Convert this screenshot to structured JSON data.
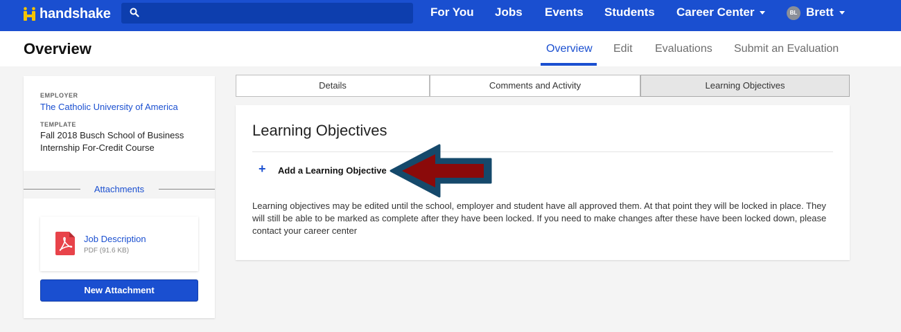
{
  "nav": {
    "brand": "handshake",
    "search_placeholder": "",
    "items": [
      {
        "label": "For You"
      },
      {
        "label": "Jobs"
      },
      {
        "label": "Events"
      },
      {
        "label": "Students"
      },
      {
        "label": "Career Center"
      }
    ],
    "user": {
      "initials": "BL",
      "name": "Brett"
    }
  },
  "header": {
    "title": "Overview",
    "tabs": [
      {
        "label": "Overview",
        "active": true
      },
      {
        "label": "Edit"
      },
      {
        "label": "Evaluations"
      },
      {
        "label": "Submit an Evaluation"
      }
    ]
  },
  "sidebar": {
    "employer_label": "EMPLOYER",
    "employer_name": "The Catholic University of America",
    "template_label": "TEMPLATE",
    "template_name": "Fall 2018 Busch School of Business Internship For-Credit Course",
    "attachments_title": "Attachments",
    "file": {
      "name": "Job Description",
      "meta": "PDF (91.6 KB)"
    },
    "new_attachment_label": "New Attachment"
  },
  "segments": [
    {
      "label": "Details"
    },
    {
      "label": "Comments and Activity"
    },
    {
      "label": "Learning Objectives",
      "active": true
    }
  ],
  "main": {
    "heading": "Learning Objectives",
    "add_label": "Add a Learning Objective",
    "description": "Learning objectives may be edited until the school, employer and student have all approved them. At that point they will be locked in place. They will still be able to be marked as complete after they have been locked. If you need to make changes after these have been locked down, please contact your career center"
  },
  "colors": {
    "brand_blue": "#1a4fd0",
    "arrow_fill": "#8b0a0a",
    "arrow_outline": "#15496b"
  },
  "icons": [
    "handshake-logo-icon",
    "search-icon",
    "caret-down-icon",
    "avatar",
    "pdf-icon",
    "plus-icon",
    "arrow-annotation"
  ]
}
